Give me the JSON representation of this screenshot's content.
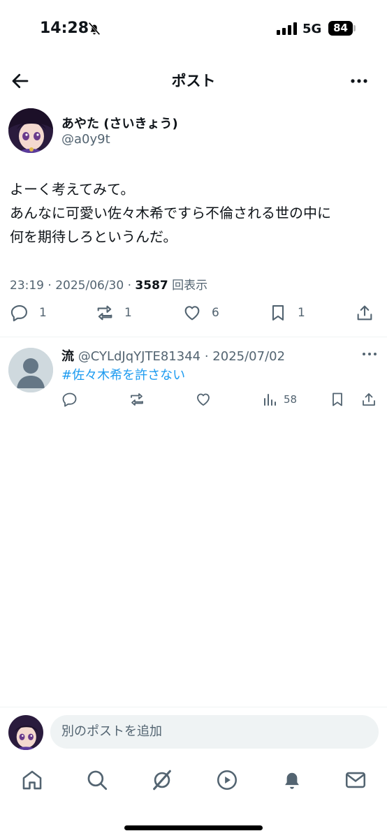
{
  "status_bar": {
    "time": "14:28",
    "network": "5G",
    "battery": "84"
  },
  "header": {
    "title": "ポスト"
  },
  "post": {
    "author_name": "あやた (さいきょう)",
    "author_handle": "@a0y9t",
    "text": "よーく考えてみて。\nあんなに可愛い佐々木希ですら不倫される世の中に\n何を期待しろというんだ。",
    "time": "23:19 · 2025/06/30 · ",
    "views": "3587",
    "views_label": " 回表示",
    "replies": "1",
    "reposts": "1",
    "likes": "6",
    "bookmarks": "1"
  },
  "reply": {
    "name": "流",
    "handle": "@CYLdJqYJTE81344",
    "date": "· 2025/07/02",
    "text": "#佐々木希を許さない",
    "views": "58"
  },
  "compose": {
    "placeholder": "別のポストを追加"
  },
  "colors": {
    "accent": "#1d9bf0",
    "secondary_text": "#536471",
    "divider": "#eff3f4"
  }
}
